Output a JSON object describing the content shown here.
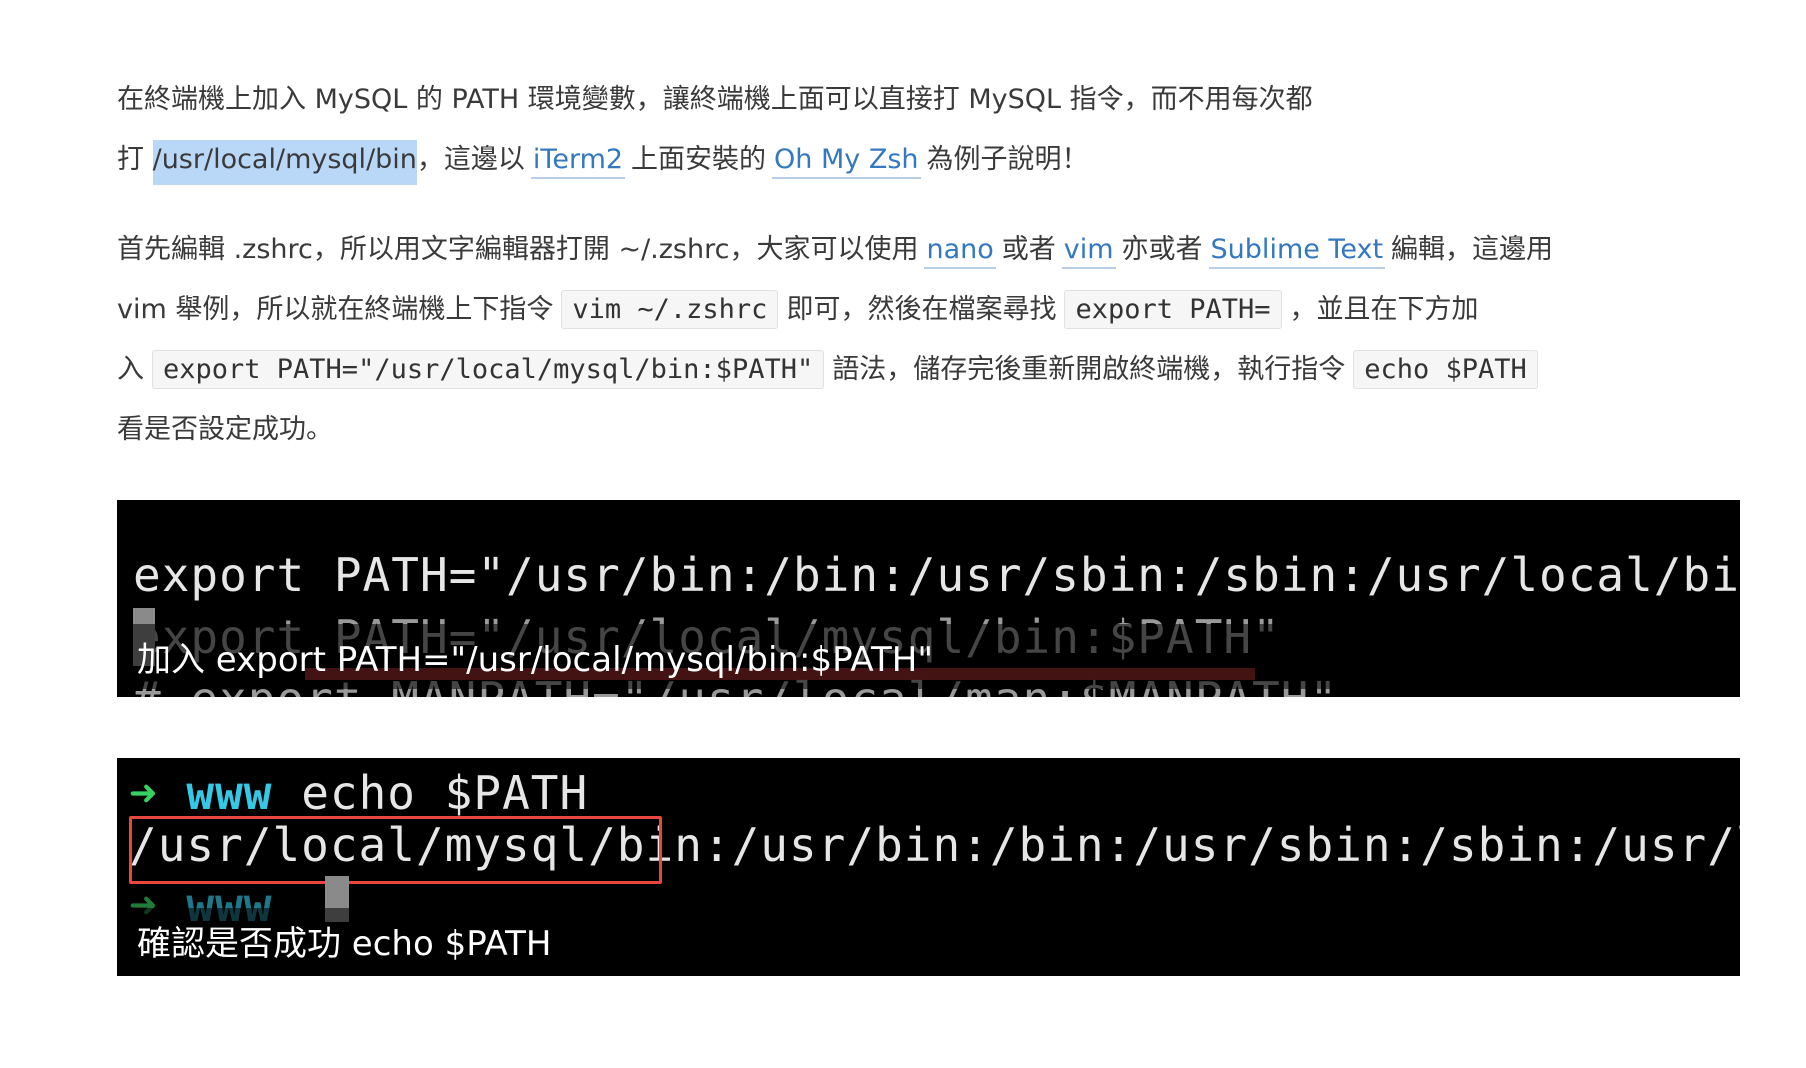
{
  "article": {
    "p1": {
      "t1": "在終端機上加入 MySQL 的 PATH 環境變數，讓終端機上面可以直接打 MySQL 指令，而不用每次都",
      "t2": "打 ",
      "highlight": "/usr/local/mysql/bin",
      "t3": "，這邊以",
      "link_iterm": "iTerm2",
      "t4": "上面安裝的",
      "link_ohmyzsh": "Oh My Zsh",
      "t5": "為例子說明！"
    },
    "p2": {
      "t1": "首先編輯 .zshrc，所以用文字編輯器打開 ~/.zshrc，大家可以使用",
      "link_nano": "nano",
      "t2": "或者",
      "link_vim": "vim",
      "t3": "亦或者",
      "link_sublime": "Sublime Text",
      "t4": "編輯，這邊用",
      "t5": "vim 舉例，所以就在終端機上下指令",
      "code_vim": "vim ~/.zshrc",
      "t6": "即可，然後在檔案尋找",
      "code_export": "export PATH=",
      "t7": "，並且在下方加",
      "t8": "入",
      "code_full": "export PATH=\"/usr/local/mysql/bin:$PATH\"",
      "t9": "語法，儲存完後重新開啟終端機，執行指令",
      "code_echo": "echo $PATH",
      "t10": "看是否設定成功。"
    }
  },
  "screenshot1": {
    "line1": "export PATH=\"/usr/bin:/bin:/usr/sbin:/sbin:/usr/local/bin\"",
    "line2_partial": "export PATH=\"/usr/local/mysql/bin:$PATH\"",
    "line3_partial": "# export MANPATH=\"/usr/local/man:$MANPATH\"",
    "caption": "加入 export PATH=\"/usr/local/mysql/bin:$PATH\""
  },
  "screenshot2": {
    "prompt_arrow": "➜",
    "prompt_dir": "www",
    "command": "echo $PATH",
    "output_highlight": "/usr/local/mysql/bin:",
    "output_rest": "/usr/bin:/bin:/usr/sbin:/sbin:/usr/local/bin",
    "caption": "確認是否成功 echo $PATH"
  },
  "colors": {
    "link": "#3478c0",
    "highlight": "#b9d8f8",
    "terminal_bg": "#000000",
    "prompt_green": "#36d160",
    "prompt_cyan": "#35c8e6",
    "red_box": "#e8473f"
  }
}
